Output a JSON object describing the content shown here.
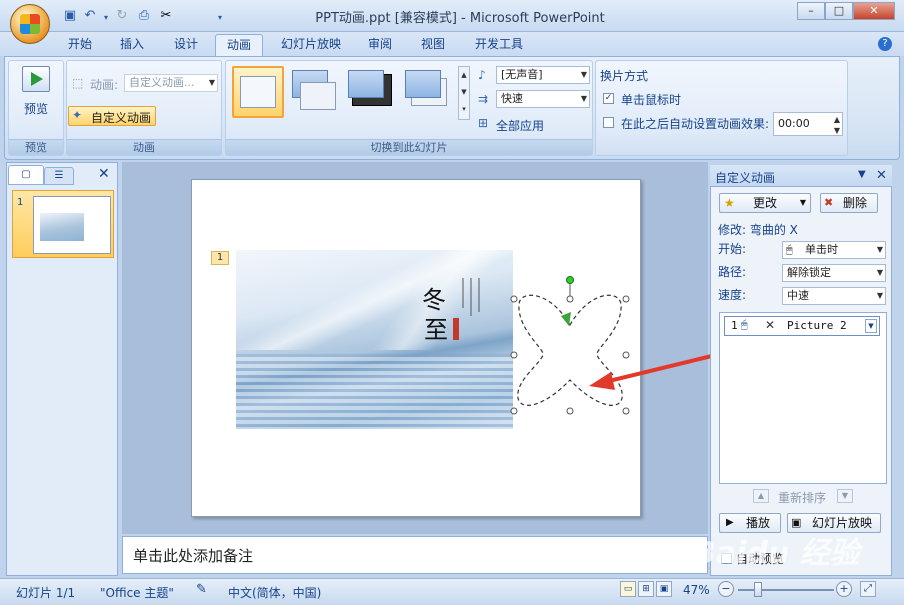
{
  "window": {
    "title": "PPT动画.ppt [兼容模式] - Microsoft PowerPoint",
    "min": "–",
    "max": "□",
    "close": "✕"
  },
  "qat": {
    "save_icon": "save-icon",
    "undo_icon": "undo-icon",
    "redo_icon": "redo-icon",
    "preview_icon": "print-preview-icon"
  },
  "tabs": [
    "开始",
    "插入",
    "设计",
    "动画",
    "幻灯片放映",
    "审阅",
    "视图",
    "开发工具"
  ],
  "ribbon": {
    "preview_group": {
      "button": "预览",
      "title": "预览"
    },
    "animation_group": {
      "animation_label": "动画:",
      "animation_value": "自定义动画...",
      "custom_button": "自定义动画",
      "title": "动画"
    },
    "transition_group": {
      "sound_value": "[无声音]",
      "speed_value": "快速",
      "apply_all": "全部应用",
      "title": "切换到此幻灯片"
    },
    "advance_group": {
      "heading": "换片方式",
      "on_click": "单击鼠标时",
      "on_click_checked": true,
      "auto_after": "在此之后自动设置动画效果:",
      "auto_after_checked": false,
      "time_value": "00:00"
    }
  },
  "left_panel": {
    "slide_number": "1"
  },
  "slide": {
    "animation_tag": "1",
    "pic_text_big1": "冬",
    "pic_text_big2": "至"
  },
  "notes": {
    "placeholder": "单击此处添加备注"
  },
  "task_pane": {
    "title": "自定义动画",
    "change_button": "更改",
    "delete_button": "删除",
    "modify_label": "修改: 弯曲的 X",
    "start_label": "开始:",
    "start_value": "单击时",
    "path_label": "路径:",
    "path_value": "解除锁定",
    "speed_label": "速度:",
    "speed_value": "中速",
    "list_item": {
      "index": "1",
      "name": "Picture 2"
    },
    "reorder_label": "重新排序",
    "play_button": "播放",
    "slideshow_button": "幻灯片放映",
    "auto_preview": "自动预览"
  },
  "status": {
    "slide": "幻灯片 1/1",
    "theme": "\"Office 主题\"",
    "language": "中文(简体，中国)",
    "zoom": "47%"
  },
  "watermark": "Baidu 经验"
}
